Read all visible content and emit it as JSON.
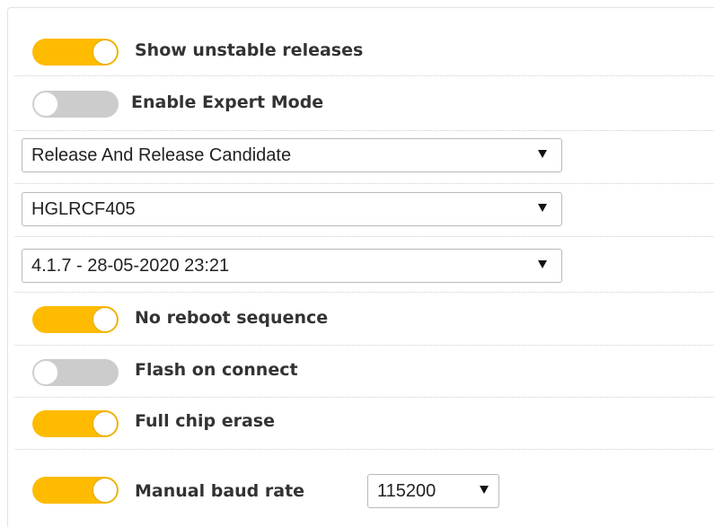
{
  "settings": {
    "show_unstable": {
      "label": "Show unstable releases",
      "on": true
    },
    "expert_mode": {
      "label": "Enable Expert Mode",
      "on": false
    },
    "release_type": {
      "value": "Release And Release Candidate"
    },
    "board": {
      "value": "HGLRCF405"
    },
    "firmware_version": {
      "value": "4.1.7 - 28-05-2020 23:21"
    },
    "no_reboot": {
      "label": "No reboot sequence",
      "on": true
    },
    "flash_on_connect": {
      "label": "Flash on connect",
      "on": false
    },
    "full_chip_erase": {
      "label": "Full chip erase",
      "on": true
    },
    "manual_baud": {
      "label": "Manual baud rate",
      "on": true,
      "baud_value": "115200"
    }
  },
  "colors": {
    "toggle_on": "#ffbb00",
    "toggle_off": "#cccccc",
    "label_text": "#333333"
  },
  "icons": {
    "dropdown": "dropdown-arrow-icon"
  }
}
